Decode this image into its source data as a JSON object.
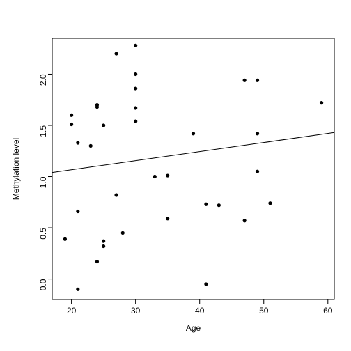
{
  "chart_data": {
    "type": "scatter",
    "title": "",
    "xlabel": "Age",
    "ylabel": "Methylation level",
    "xlim": [
      17,
      61
    ],
    "ylim": [
      -0.2,
      2.35
    ],
    "x_ticks": [
      20,
      30,
      40,
      50,
      60
    ],
    "y_ticks": [
      0.0,
      0.5,
      1.0,
      1.5,
      2.0
    ],
    "series": [
      {
        "name": "points",
        "x": [
          19,
          20,
          20,
          21,
          21,
          21,
          23,
          24,
          24,
          24,
          25,
          25,
          25,
          27,
          27,
          28,
          30,
          30,
          30,
          30,
          30,
          33,
          35,
          35,
          39,
          41,
          41,
          43,
          47,
          47,
          49,
          49,
          49,
          51,
          59
        ],
        "y": [
          0.39,
          1.51,
          1.6,
          -0.1,
          0.66,
          1.33,
          1.3,
          0.17,
          1.68,
          1.7,
          0.32,
          0.37,
          1.5,
          0.82,
          2.2,
          0.45,
          1.54,
          1.67,
          1.86,
          2.0,
          2.28,
          1.0,
          0.59,
          1.01,
          1.42,
          -0.05,
          0.73,
          0.72,
          0.57,
          1.94,
          1.05,
          1.42,
          1.94,
          0.74,
          1.72
        ]
      }
    ],
    "regression": {
      "x1": 17,
      "y1": 1.04,
      "x2": 61,
      "y2": 1.43
    },
    "grid": false,
    "legend": null
  },
  "labels": {
    "xlabel": "Age",
    "ylabel": "Methylation level",
    "x_ticks": [
      "20",
      "30",
      "40",
      "50",
      "60"
    ],
    "y_ticks": [
      "0.0",
      "0.5",
      "1.0",
      "1.5",
      "2.0"
    ]
  }
}
